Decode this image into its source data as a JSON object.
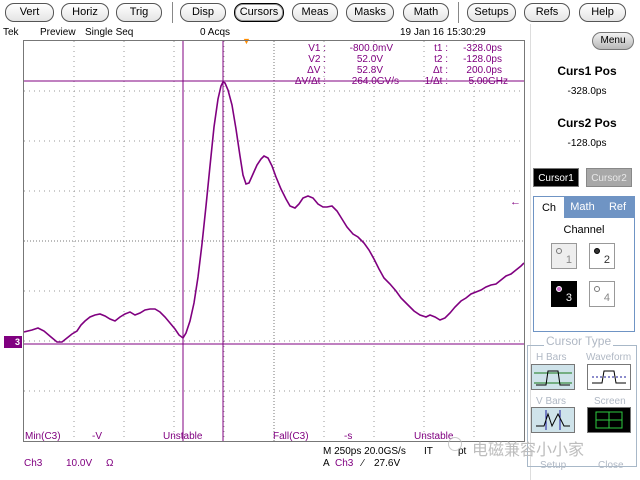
{
  "menu": {
    "items": [
      "Vert",
      "Horiz",
      "Trig",
      "Disp",
      "Cursors",
      "Meas",
      "Masks",
      "Math",
      "Setups",
      "Refs",
      "Help"
    ],
    "active": "Cursors"
  },
  "status": {
    "brand": "Tek",
    "mode": "Preview",
    "acq_mode": "Single Seq",
    "acqs": "0 Acqs",
    "datetime": "19 Jan 16 15:30:29"
  },
  "readouts": {
    "v1_label": "V1 :",
    "v1": "-800.0mV",
    "v2_label": "V2 :",
    "v2": "52.0V",
    "dv_label": "ΔV :",
    "dv": "52.8V",
    "dvdt_label": "ΔV/Δt :",
    "dvdt": "264.0GV/s",
    "t1_label": "t1 :",
    "t1": "-328.0ps",
    "t2_label": "t2 :",
    "t2": "-128.0ps",
    "dt_label": "Δt :",
    "dt": "200.0ps",
    "inv_dt_label": "1/Δt :",
    "inv_dt": "5.00GHz"
  },
  "measurements": {
    "min": "Min(C3)",
    "min_val": "-V",
    "min_state": "Unstable",
    "fall": "Fall(C3)",
    "fall_val": "-s",
    "fall_state": "Unstable"
  },
  "bottom": {
    "channel": "Ch3",
    "scale": "10.0V",
    "impedance": "Ω",
    "timebase": "M 250ps 20.0GS/s",
    "it": "IT",
    "pts": "pt",
    "trig_mode": "A",
    "trig_ch": "Ch3",
    "slope": "∕",
    "trig_level": "27.6V"
  },
  "panel": {
    "menu": "Menu",
    "curs1_title": "Curs1 Pos",
    "curs1_val": "-328.0ps",
    "curs2_title": "Curs2 Pos",
    "curs2_val": "-128.0ps",
    "cursor1": "Cursor1",
    "cursor2": "Cursor2",
    "tabs": [
      "Ch",
      "Math",
      "Ref"
    ],
    "channel_label": "Channel",
    "channels": [
      "1",
      "2",
      "3",
      "4"
    ],
    "selected_channel": "3",
    "cursor_type": "Cursor Type",
    "h_bars": "H Bars",
    "waveform": "Waveform",
    "v_bars": "V Bars",
    "screen": "Screen",
    "setup": "Setup",
    "close": "Close"
  },
  "watermark": "电磁兼容小小家",
  "markers": {
    "ground": "3",
    "trigger_pos": "▼",
    "level": "←"
  },
  "colors": {
    "trace": "#800080",
    "accent": "#ff8c00",
    "panel_tab": "#6f94c4"
  }
}
